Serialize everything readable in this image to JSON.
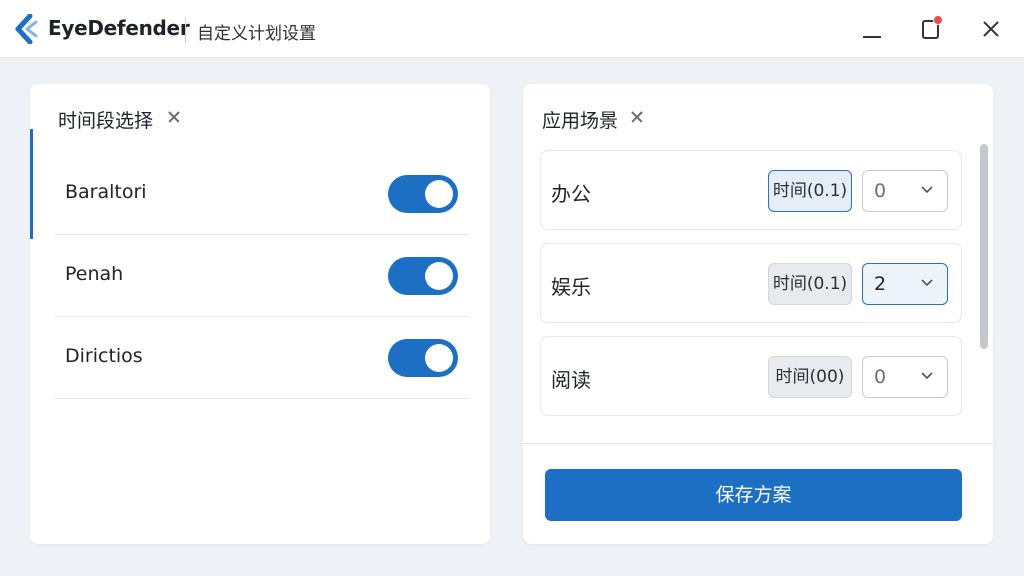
{
  "app": {
    "name": "EyeDefender",
    "window_subtitle": "自定义计划设置"
  },
  "time_panel": {
    "title": "时间段选择",
    "items": [
      {
        "label": "Baraltori",
        "enabled": true
      },
      {
        "label": "Penah",
        "enabled": true
      },
      {
        "label": "Dirictios",
        "enabled": true
      }
    ]
  },
  "scene_panel": {
    "title": "应用场景",
    "scenes": [
      {
        "name": "办公",
        "time_label": "时间(0.1)",
        "select_value": "0"
      },
      {
        "name": "娱乐",
        "time_label": "时间(0.1)",
        "select_value": "2"
      },
      {
        "name": "阅读",
        "time_label": "时间(00)",
        "select_value": "0"
      }
    ],
    "save_label": "保存方案"
  },
  "colors": {
    "accent": "#1c6fc3",
    "notification_dot": "#e84b4b",
    "background": "#eef1f5"
  }
}
